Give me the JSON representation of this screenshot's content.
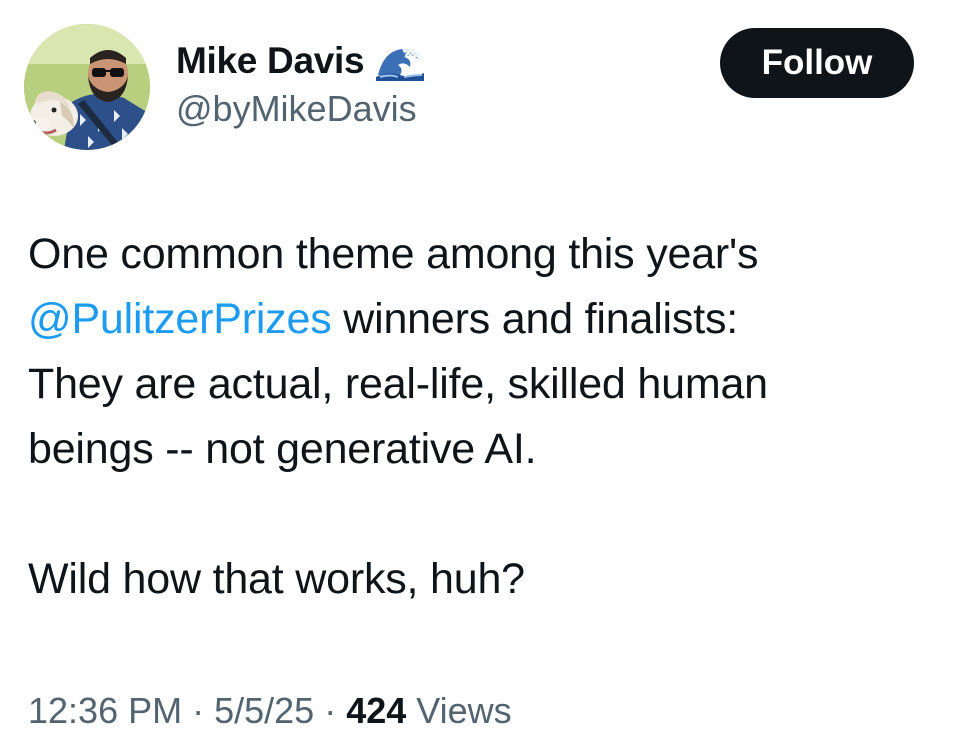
{
  "author": {
    "display_name": "Mike Davis",
    "handle": "@byMikeDavis",
    "name_emoji_icon": "wave-icon"
  },
  "follow_button": {
    "label": "Follow"
  },
  "tweet": {
    "line1": "One common theme among this year's",
    "mention": "@PulitzerPrizes",
    "line2_rest": " winners and finalists:",
    "line3": "They are actual, real-life, skilled human",
    "line4": "beings -- not generative AI.",
    "line5": "Wild how that works, huh?"
  },
  "meta": {
    "time": "12:36 PM",
    "separator1": " · ",
    "date": "5/5/25",
    "separator2": " · ",
    "views_count": "424",
    "views_label": " Views"
  },
  "colors": {
    "text": "#0f1419",
    "secondary": "#536471",
    "link": "#1d9bf0",
    "button_bg": "#0f1419",
    "button_text": "#ffffff"
  }
}
